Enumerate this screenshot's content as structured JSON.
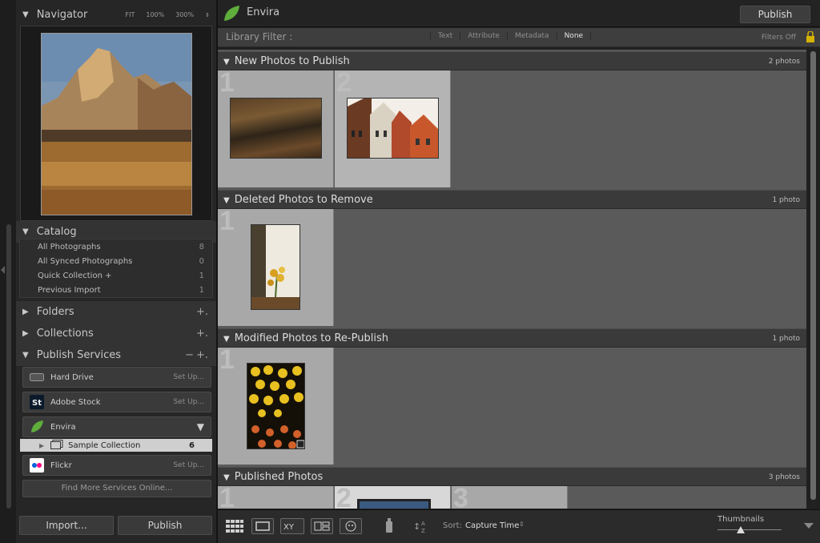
{
  "navigator": {
    "title": "Navigator",
    "zoom": [
      "FIT",
      "100%",
      "300%"
    ]
  },
  "catalog": {
    "title": "Catalog",
    "items": [
      {
        "label": "All Photographs",
        "count": "8"
      },
      {
        "label": "All Synced Photographs",
        "count": "0"
      },
      {
        "label": "Quick Collection +",
        "count": "1"
      },
      {
        "label": "Previous Import",
        "count": "1"
      }
    ]
  },
  "folders": {
    "title": "Folders"
  },
  "collections": {
    "title": "Collections"
  },
  "publish_services": {
    "title": "Publish Services",
    "services": [
      {
        "label": "Hard Drive",
        "action": "Set Up..."
      },
      {
        "label": "Adobe Stock",
        "action": "Set Up..."
      },
      {
        "label": "Envira"
      },
      {
        "label": "Flickr",
        "action": "Set Up..."
      }
    ],
    "collection": {
      "label": "Sample Collection",
      "count": "6"
    },
    "find_more": "Find More Services Online..."
  },
  "left_bottom": {
    "import": "Import...",
    "publish": "Publish"
  },
  "header": {
    "title": "Envira",
    "publish": "Publish"
  },
  "filter": {
    "label": "Library Filter :",
    "options": [
      "Text",
      "Attribute",
      "Metadata",
      "None"
    ],
    "active": "None",
    "status": "Filters Off"
  },
  "sections": [
    {
      "title": "New Photos to Publish",
      "count": "2 photos"
    },
    {
      "title": "Deleted Photos to Remove",
      "count": "1 photo"
    },
    {
      "title": "Modified Photos to Re-Publish",
      "count": "1 photo"
    },
    {
      "title": "Published Photos",
      "count": "3 photos"
    }
  ],
  "cell_numbers": [
    "1",
    "2",
    "1",
    "1",
    "1",
    "2",
    "3"
  ],
  "toolbar": {
    "sort_label": "Sort:",
    "sort_value": "Capture Time",
    "thumbnails_label": "Thumbnails"
  },
  "colors": {
    "accent_green": "#5fae3c",
    "flickr_pink": "#ff0084",
    "flickr_blue": "#0063dc"
  }
}
